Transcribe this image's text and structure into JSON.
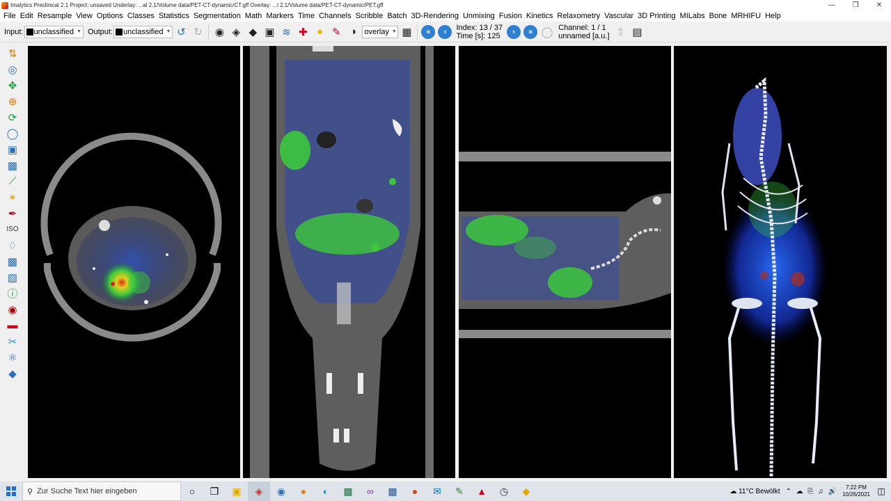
{
  "window": {
    "title": "Imalytics Preclinical 2.1 Project: unsaved   Underlay: ...al 2.1/Volume data/PET-CT-dynamic/CT.gff   Overlay: ...l 2.1/Volume data/PET-CT-dynamic/PET.gff"
  },
  "menu": [
    "File",
    "Edit",
    "Resample",
    "View",
    "Options",
    "Classes",
    "Statistics",
    "Segmentation",
    "Math",
    "Markers",
    "Time",
    "Channels",
    "Scribble",
    "Batch",
    "3D-Rendering",
    "Unmixing",
    "Fusion",
    "Kinetics",
    "Relaxometry",
    "Vascular",
    "3D Printing",
    "MILabs",
    "Bone",
    "MRHIFU",
    "Help"
  ],
  "toolbar": {
    "input_label": "Input:",
    "input_value": "unclassified",
    "output_label": "Output:",
    "output_value": "unclassified",
    "blend_mode": "overlay",
    "index_label": "Index: 13 / 37",
    "time_label": "Time [s]: 125",
    "channel_label": "Channel: 1 / 1",
    "unit_label": "unnamed [a.u.]"
  },
  "taskbar": {
    "search_placeholder": "Zur Suche Text hier eingeben",
    "weather": "11°C  Bewölkt",
    "time": "7:22 PM",
    "date": "10/26/2021"
  },
  "colors": {
    "accent": "#2f7fd1",
    "pet_high": "#e0d020",
    "pet_mid": "#3cc83c",
    "pet_low": "#2a4fb0"
  }
}
